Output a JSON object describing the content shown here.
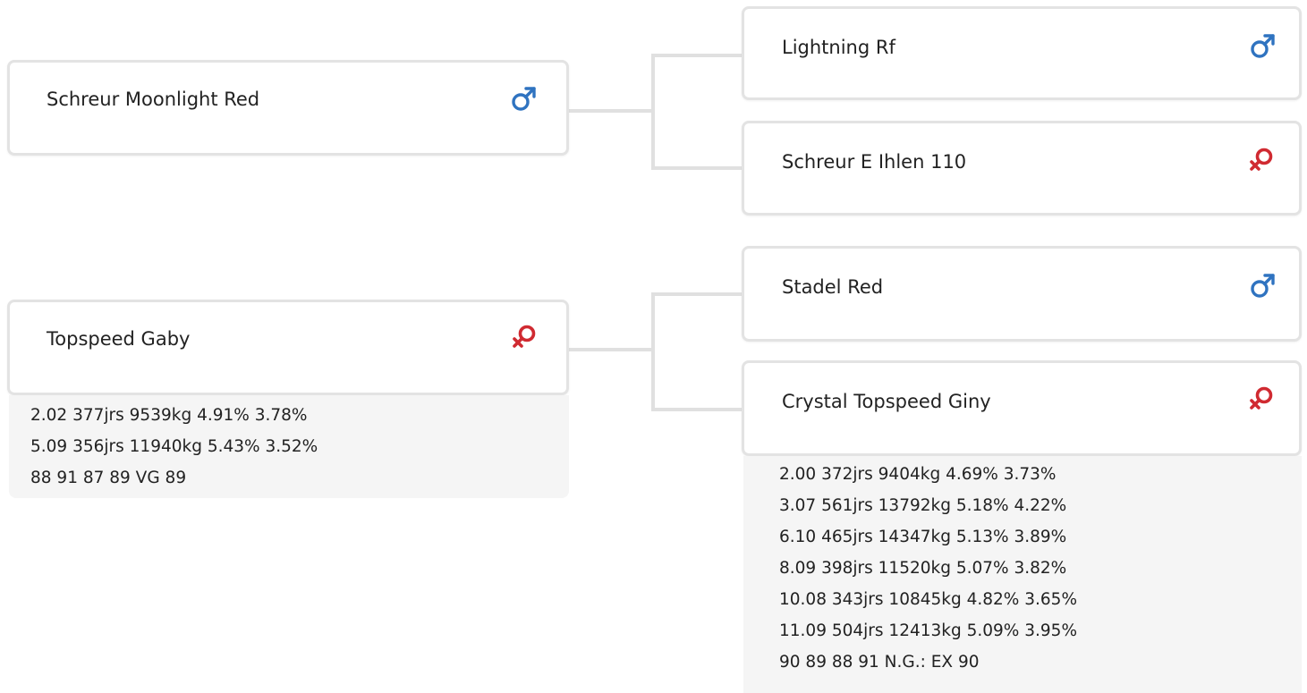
{
  "colors": {
    "male": "#2f73c0",
    "female": "#d02a31",
    "card_border": "#e3e3e3",
    "stats_bg": "#f5f5f5",
    "connector": "#e0e0e0"
  },
  "pedigree": {
    "sire": {
      "name": "Schreur Moonlight Red",
      "sex_icon": "male-icon",
      "sire": {
        "name": "Lightning Rf",
        "sex_icon": "male-icon"
      },
      "dam": {
        "name": "Schreur E Ihlen 110",
        "sex_icon": "female-icon"
      }
    },
    "dam": {
      "name": "Topspeed Gaby",
      "sex_icon": "female-icon",
      "stats": [
        "2.02 377jrs 9539kg 4.91% 3.78%",
        "5.09 356jrs 11940kg 5.43% 3.52%",
        "88 91 87 89 VG 89"
      ],
      "sire": {
        "name": "Stadel Red",
        "sex_icon": "male-icon"
      },
      "dam": {
        "name": "Crystal Topspeed Giny",
        "sex_icon": "female-icon",
        "stats": [
          "2.00 372jrs 9404kg 4.69% 3.73%",
          "3.07 561jrs 13792kg 5.18% 4.22%",
          "6.10 465jrs 14347kg 5.13% 3.89%",
          "8.09 398jrs 11520kg 5.07% 3.82%",
          "10.08 343jrs 10845kg 4.82% 3.65%",
          "11.09 504jrs 12413kg 5.09% 3.95%",
          "90 89 88 91 N.G.: EX 90"
        ]
      }
    }
  }
}
